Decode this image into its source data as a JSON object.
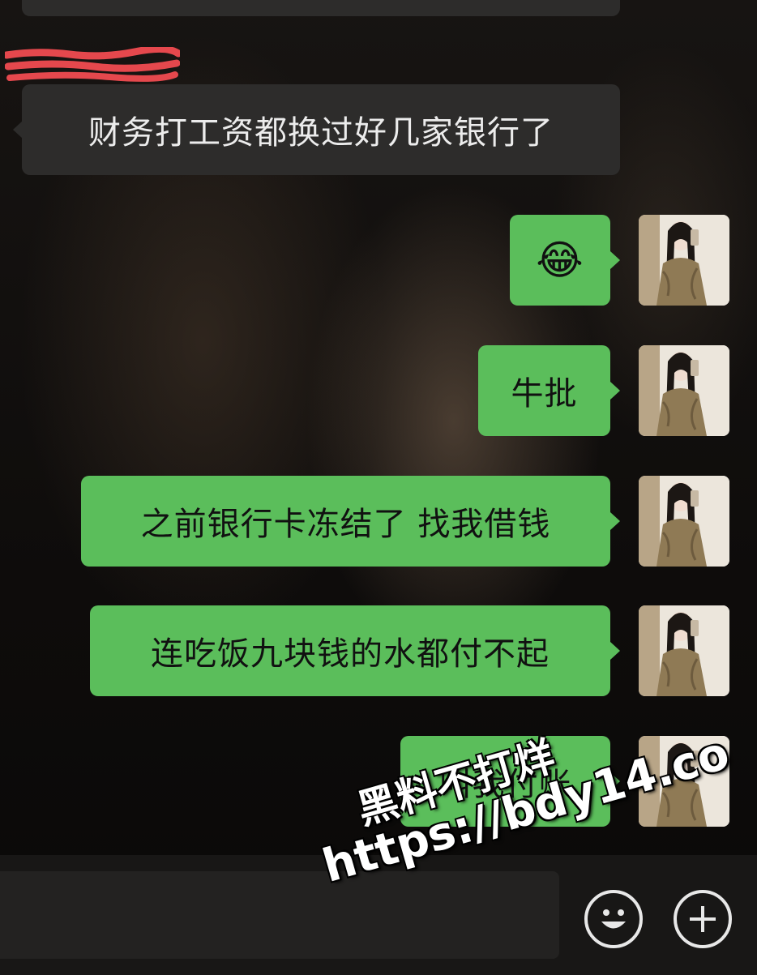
{
  "messages": [
    {
      "direction": "in",
      "text": "财务打工资都换过好几家银行了"
    },
    {
      "direction": "out",
      "emoji": "😂"
    },
    {
      "direction": "out",
      "text": "牛批"
    },
    {
      "direction": "out",
      "text": "之前银行卡冻结了 找我借钱"
    },
    {
      "direction": "out",
      "text": "连吃饭九块钱的水都付不起"
    },
    {
      "direction": "out",
      "text": "叫我付账"
    }
  ],
  "icons": {
    "emoji_button": "smiley-icon",
    "more_button": "plus-icon"
  },
  "watermark": {
    "line1": "黑料不打烊",
    "line2": "https://bdy14.co"
  },
  "colors": {
    "outgoing_bubble": "#5bbe5b",
    "incoming_bubble": "#2d2c2b",
    "redaction": "#e5484d"
  }
}
